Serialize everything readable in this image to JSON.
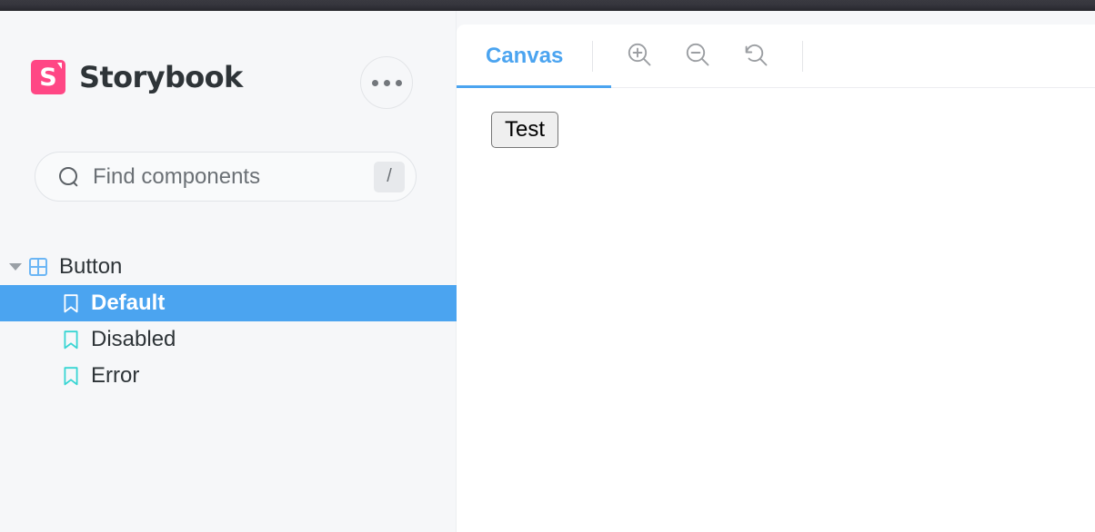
{
  "app": {
    "brand_title": "Storybook",
    "logo_letter": "S",
    "accent_pink": "#FF4785",
    "accent_blue": "#4BA4F0",
    "story_icon_teal": "#37D5D3"
  },
  "sidebar": {
    "menu_button_label": "•••",
    "search": {
      "placeholder": "Find components",
      "value": "",
      "shortcut_key": "/"
    },
    "tree": [
      {
        "label": "Button",
        "type": "component",
        "expanded": true,
        "selected": false
      },
      {
        "label": "Default",
        "type": "story",
        "expanded": false,
        "selected": true
      },
      {
        "label": "Disabled",
        "type": "story",
        "expanded": false,
        "selected": false
      },
      {
        "label": "Error",
        "type": "story",
        "expanded": false,
        "selected": false
      }
    ]
  },
  "main": {
    "tabs": [
      {
        "label": "Canvas",
        "active": true
      }
    ],
    "toolbar_buttons": [
      {
        "icon": "zoom-in-icon",
        "title": "Zoom in"
      },
      {
        "icon": "zoom-out-icon",
        "title": "Zoom out"
      },
      {
        "icon": "zoom-reset-icon",
        "title": "Reset zoom"
      }
    ],
    "preview": {
      "button_label": "Test"
    }
  }
}
